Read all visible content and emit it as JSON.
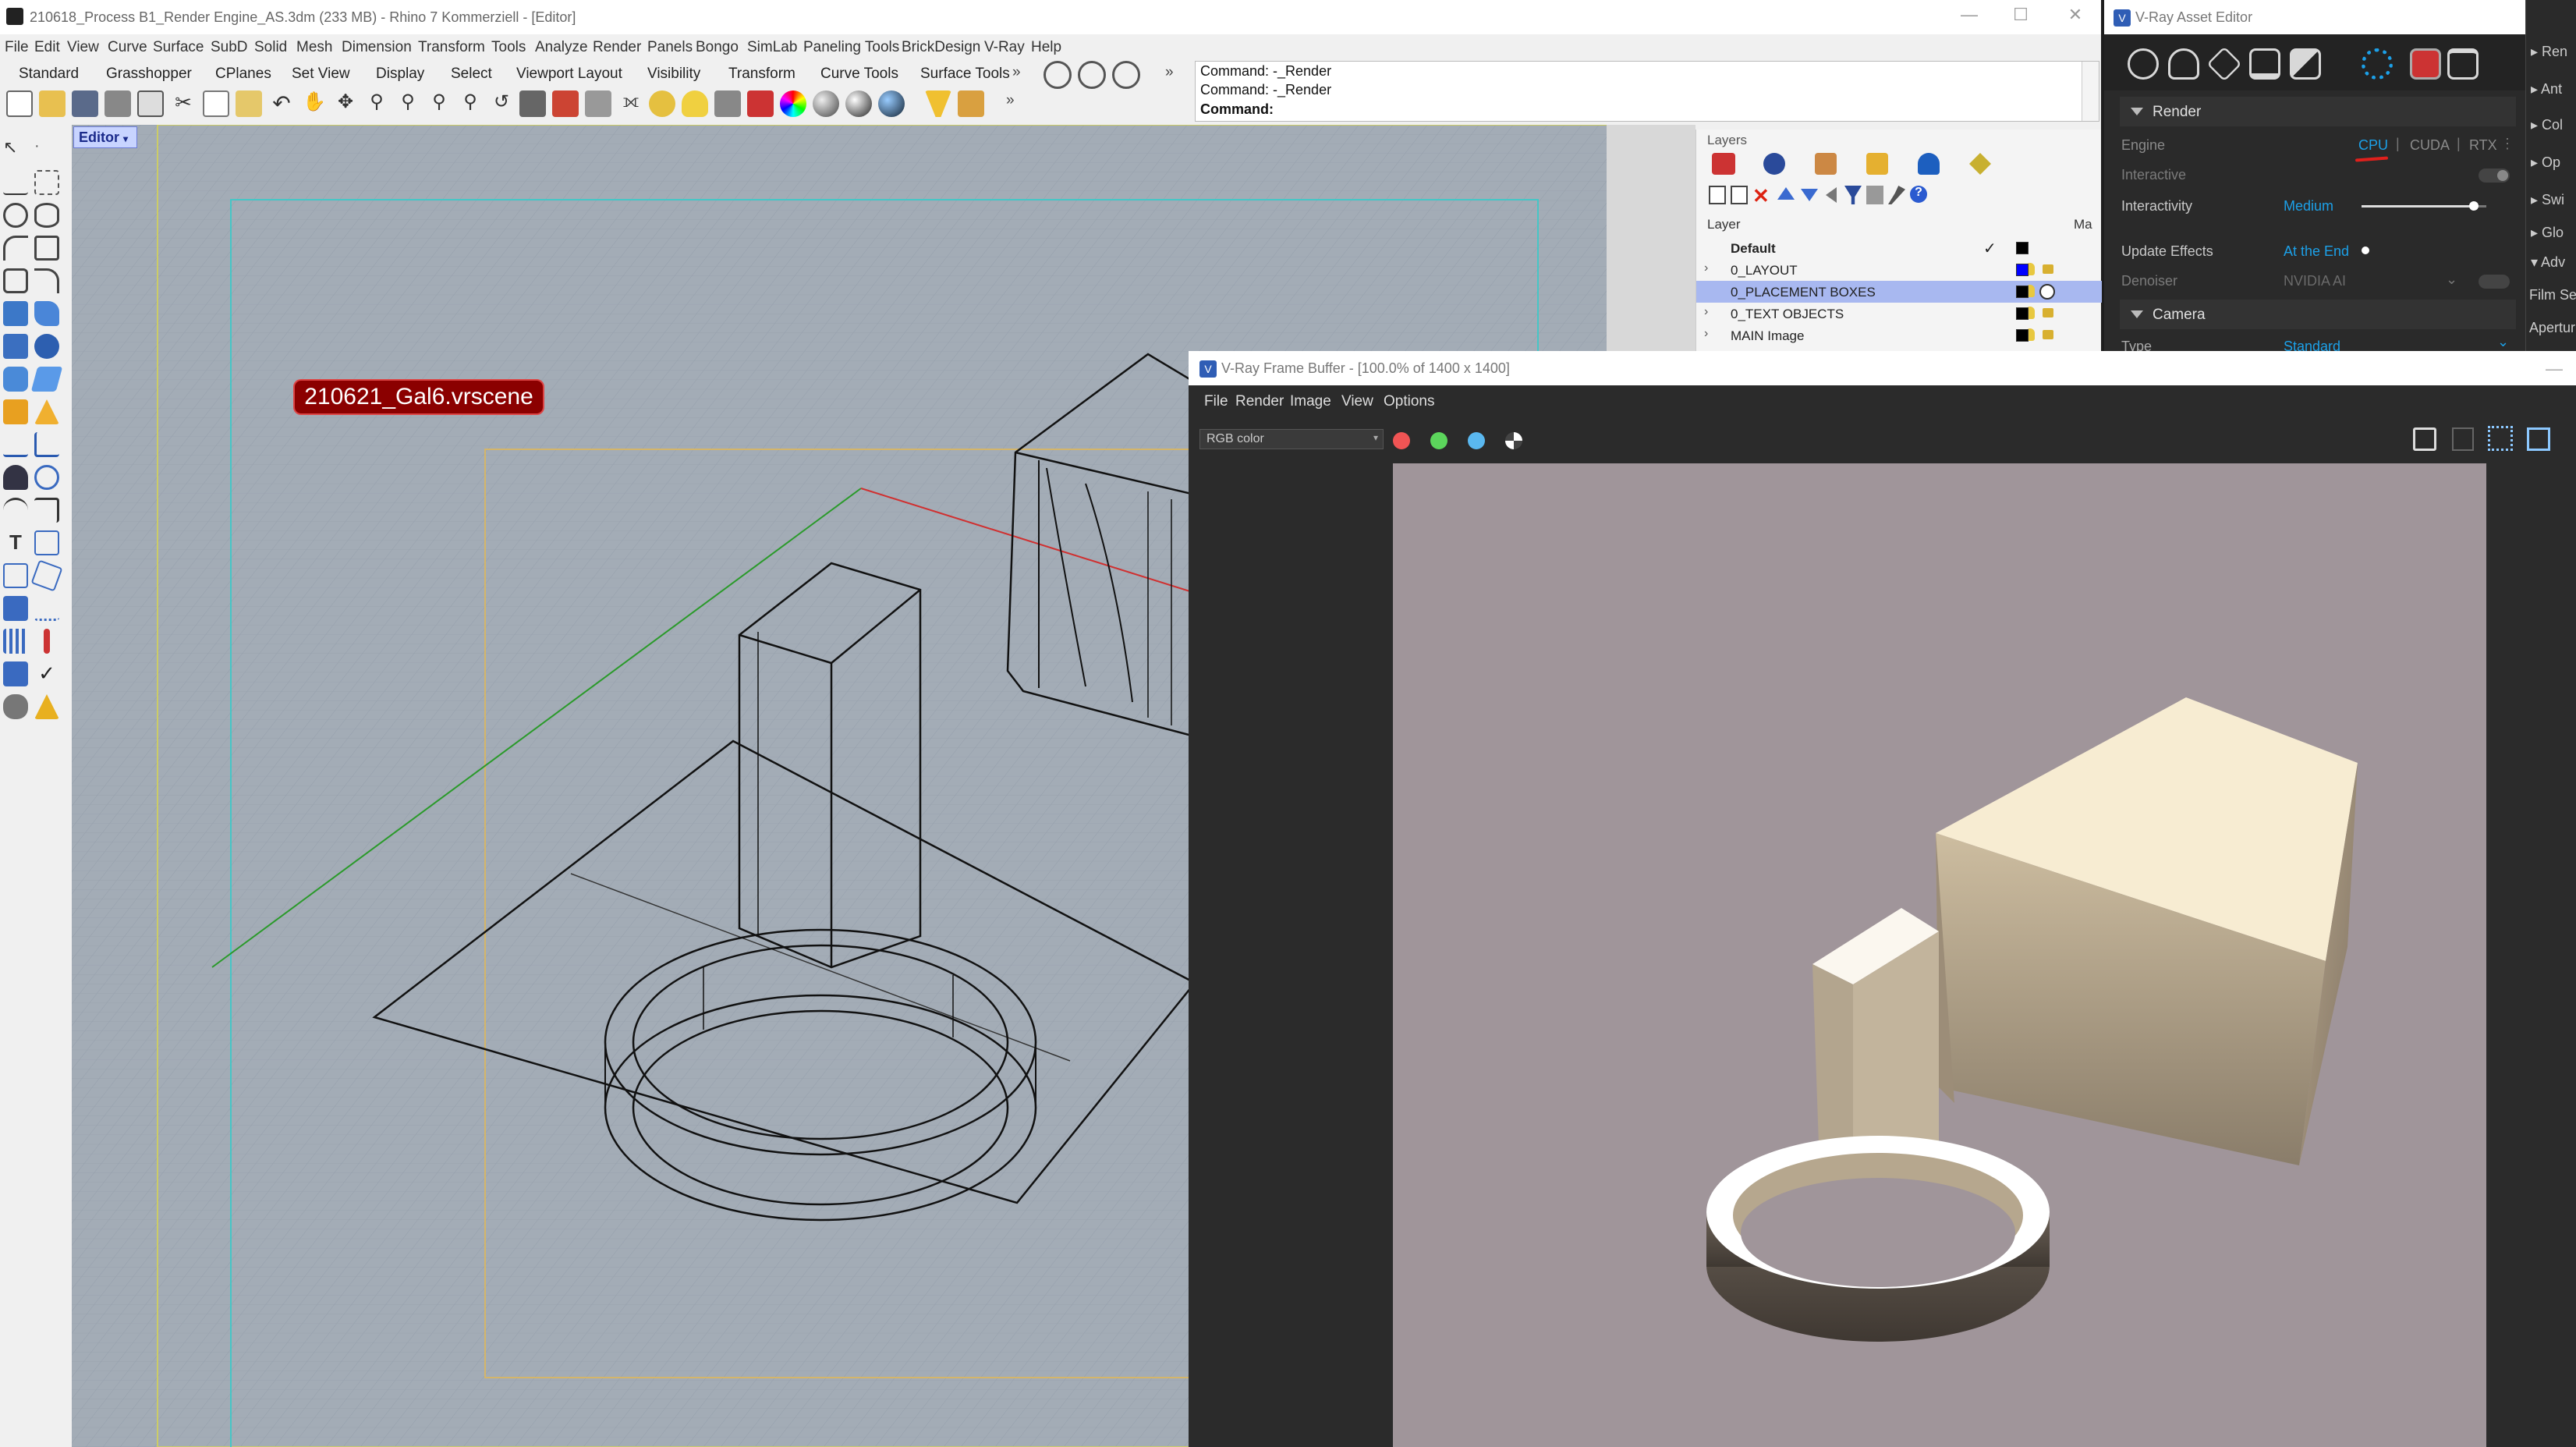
{
  "rhino": {
    "window_title": "210618_Process B1_Render Engine_AS.3dm (233 MB) - Rhino 7 Kommerziell - [Editor]",
    "menu": [
      "File",
      "Edit",
      "View",
      "Curve",
      "Surface",
      "SubD",
      "Solid",
      "Mesh",
      "Dimension",
      "Transform",
      "Tools",
      "Analyze",
      "Render",
      "Panels",
      "Bongo",
      "SimLab",
      "Paneling Tools",
      "BrickDesign",
      "V-Ray",
      "Help"
    ],
    "tabs": [
      "Standard",
      "Grasshopper",
      "CPlanes",
      "Set View",
      "Display",
      "Select",
      "Viewport Layout",
      "Visibility",
      "Transform",
      "Curve Tools",
      "Surface Tools"
    ],
    "command_history": [
      "Command: -_Render",
      "Command: -_Render"
    ],
    "command_prompt": "Command:",
    "viewport_label": "Editor",
    "viewport_tag": "210621_Gal6.vrscene"
  },
  "layers": {
    "panel_title": "Layers",
    "column_layer": "Layer",
    "column_material": "Ma",
    "rows": [
      {
        "name": "Default",
        "bold": true,
        "current": true,
        "color": "#000000"
      },
      {
        "name": "0_LAYOUT",
        "color": "#0000ff"
      },
      {
        "name": "0_PLACEMENT BOXES",
        "selected": true,
        "color": "#000000"
      },
      {
        "name": "0_TEXT OBJECTS",
        "color": "#000000"
      },
      {
        "name": "MAIN Image",
        "color": "#000000"
      }
    ]
  },
  "vray_asset_editor": {
    "title": "V-Ray Asset Editor",
    "section_render": "Render",
    "engine_label": "Engine",
    "engine_options": [
      "CPU",
      "CUDA",
      "RTX"
    ],
    "engine_selected": "CPU",
    "interactive_label": "Interactive",
    "interactivity_label": "Interactivity",
    "interactivity_value": "Medium",
    "interactivity_level": 0.9,
    "update_effects_label": "Update Effects",
    "update_effects_value": "At the End",
    "denoiser_label": "Denoiser",
    "denoiser_value": "NVIDIA AI",
    "section_camera": "Camera",
    "type_label": "Type",
    "type_value": "Standard",
    "side_items": [
      "Ren",
      "Ant",
      "Col",
      "Op",
      "Swi",
      "Glo",
      "Adv",
      "Film Se",
      "Apertur"
    ]
  },
  "vray_frame_buffer": {
    "title": "V-Ray Frame Buffer - [100.0% of 1400 x 1400]",
    "menu": [
      "File",
      "Render",
      "Image",
      "View",
      "Options"
    ],
    "channel": "RGB color",
    "accent_colors": {
      "red": "#f05454",
      "green": "#5cd65c",
      "blue": "#5ab8f0"
    }
  }
}
